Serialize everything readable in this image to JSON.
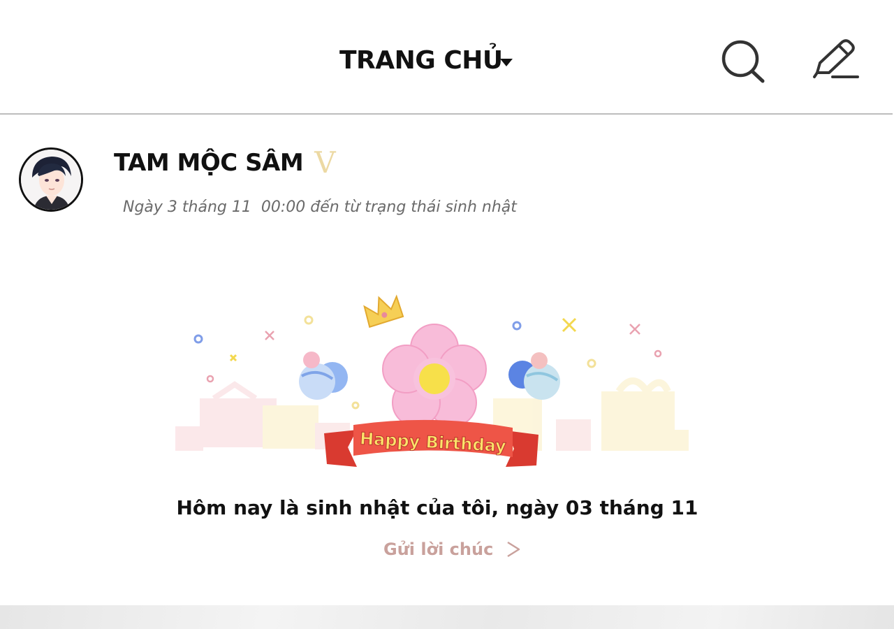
{
  "header": {
    "title": "TRANG CHỦ",
    "icons": {
      "dropdown": "caret-down-icon",
      "search": "search-icon",
      "compose": "pencil-icon"
    }
  },
  "post": {
    "author": "TAM MỘC SÂM",
    "verified_mark": "V",
    "timestamp": "Ngày 3 tháng 11  00:00 đến từ trạng thái sinh nhật",
    "banner_text": "Happy Birthday",
    "message": "Hôm nay là sinh nhật của tôi, ngày 03 tháng 11",
    "action_label": "Gửi lời chúc"
  },
  "colors": {
    "verified": "#ecd9a3",
    "action": "#c9a19c",
    "divider": "#bdbdbd",
    "ribbon": "#e8463a",
    "flower": "#f6b8d8",
    "flower_center": "#f7e04a"
  }
}
